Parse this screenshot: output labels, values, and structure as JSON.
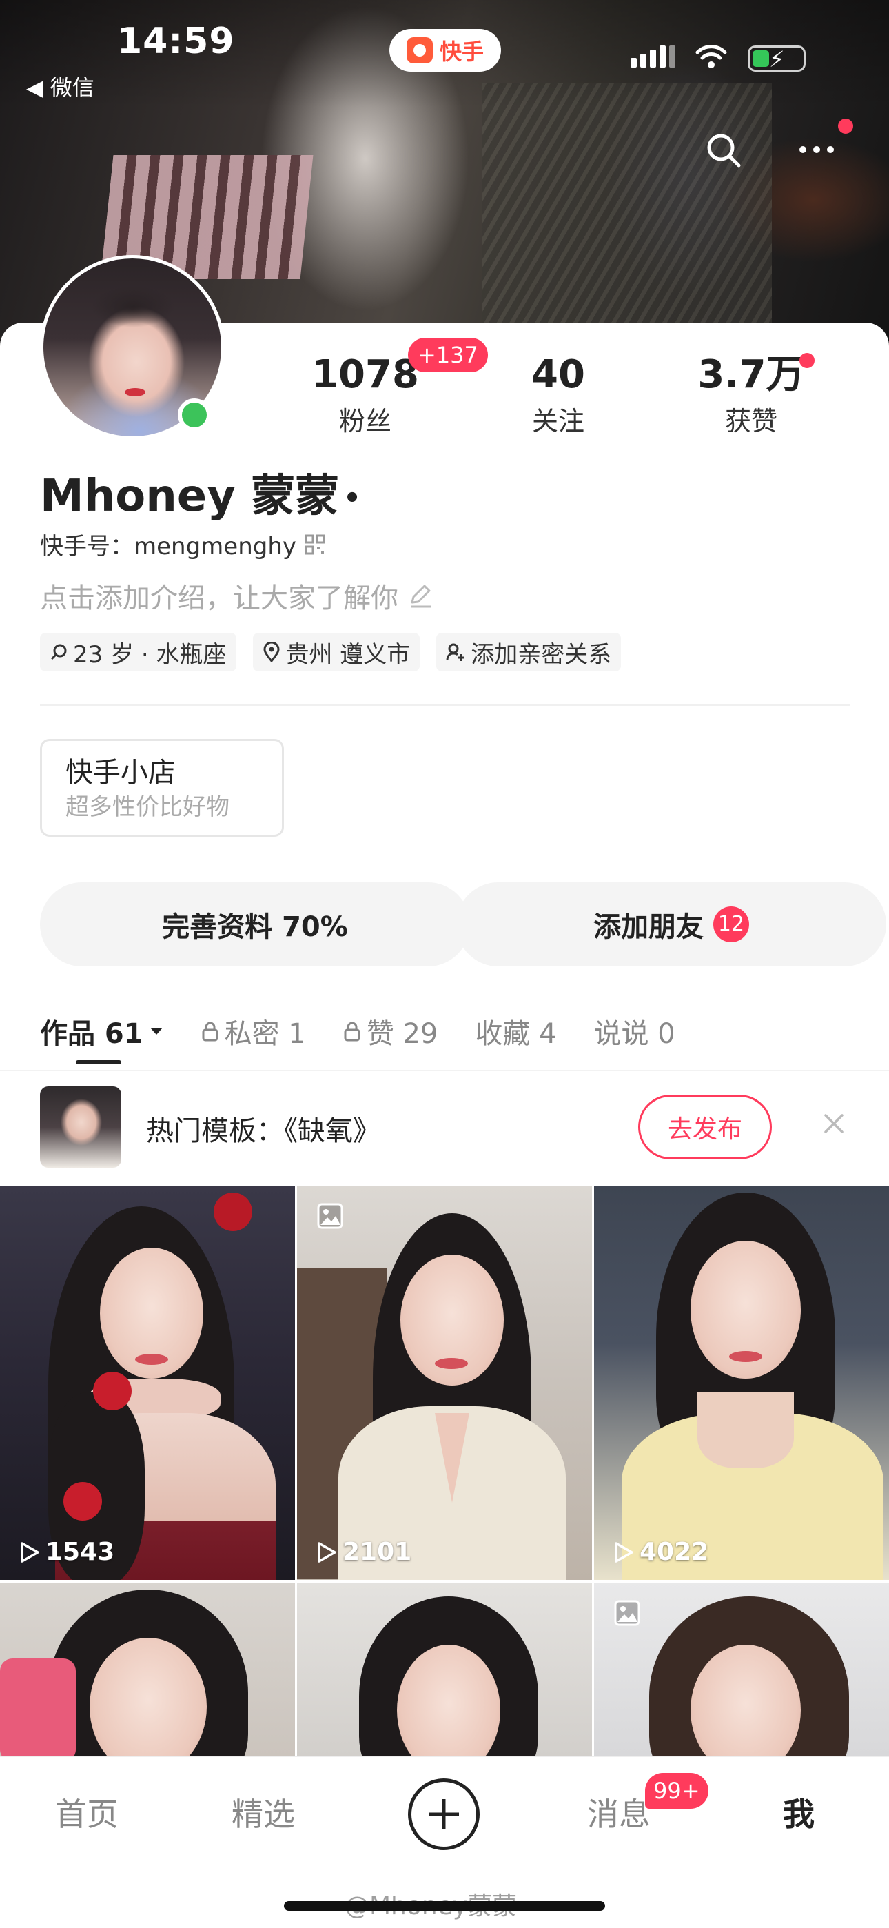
{
  "status_bar": {
    "time": "14:59",
    "back_label": "◀ 微信"
  },
  "app_pill": {
    "label": "快手",
    "icon": "kuaishou-logo-icon"
  },
  "profile": {
    "name": "Mhoney 蒙蒙",
    "name_suffix": "•",
    "id_label": "快手号：mengmenghy",
    "intro_placeholder": "点击添加介绍，让大家了解你",
    "tags": [
      "23 岁 · 水瓶座",
      "贵州 遵义市",
      "添加亲密关系"
    ]
  },
  "stats": {
    "fans": {
      "value": "1078",
      "label": "粉丝",
      "badge": "+137"
    },
    "following": {
      "value": "40",
      "label": "关注"
    },
    "likes": {
      "value": "3.7万",
      "label": "获赞"
    }
  },
  "shop": {
    "title": "快手小店",
    "subtitle": "超多性价比好物"
  },
  "actions": {
    "complete_profile": "完善资料 70%",
    "add_friend": "添加朋友",
    "add_friend_count": "12"
  },
  "tabs": [
    {
      "label": "作品 61",
      "active": true
    },
    {
      "label": "私密 1",
      "locked": true
    },
    {
      "label": "赞 29",
      "locked": true
    },
    {
      "label": "收藏 4"
    },
    {
      "label": "说说 0"
    }
  ],
  "hot_template": {
    "text": "热门模板：《缺氧》",
    "button": "去发布"
  },
  "grid": [
    {
      "views": "1543"
    },
    {
      "views": "2101"
    },
    {
      "views": "4022"
    }
  ],
  "bottom_nav": {
    "home": "首页",
    "featured": "精选",
    "messages": "消息",
    "messages_badge": "99+",
    "me": "我"
  },
  "watermark": "@Mhoney蒙蒙",
  "colors": {
    "accent": "#ff3b5c",
    "online": "#3cc35a",
    "muted": "#aaaaaa"
  }
}
